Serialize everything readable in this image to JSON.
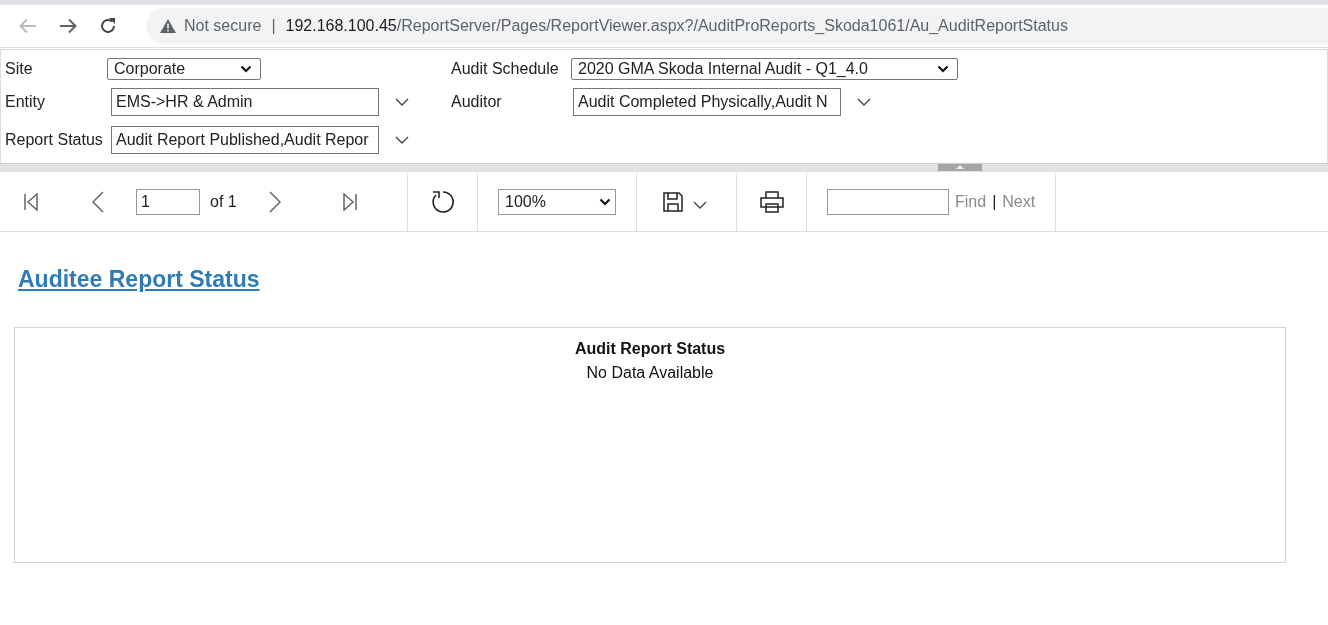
{
  "browser": {
    "back_disabled": true,
    "forward_disabled": false,
    "security": "Not secure",
    "divider": "|",
    "url_host": "192.168.100.45",
    "url_path": "/ReportServer/Pages/ReportViewer.aspx?/AuditProReports_Skoda1061/Au_AuditReportStatus"
  },
  "parameters": [
    {
      "label": "Site",
      "kind": "select",
      "value": "Corporate"
    },
    {
      "label": "Audit Schedule",
      "kind": "select",
      "value": "2020 GMA Skoda Internal Audit - Q1_4.0"
    },
    {
      "label": "Entity",
      "kind": "multi",
      "value": "EMS->HR & Admin"
    },
    {
      "label": "Auditor",
      "kind": "multi",
      "value": "Audit Completed Physically,Audit N"
    },
    {
      "label": "Report Status",
      "kind": "multi",
      "value": "Audit Report Published,Audit Repor"
    }
  ],
  "toolbar": {
    "page": "1",
    "page_count": "of 1",
    "zoom": "100%",
    "find_label": "Find",
    "separator": "|",
    "next_label": "Next",
    "find_disabled": true
  },
  "report": {
    "title": "Auditee Report Status",
    "table_title": "Audit Report Status",
    "message": "No Data Available"
  }
}
